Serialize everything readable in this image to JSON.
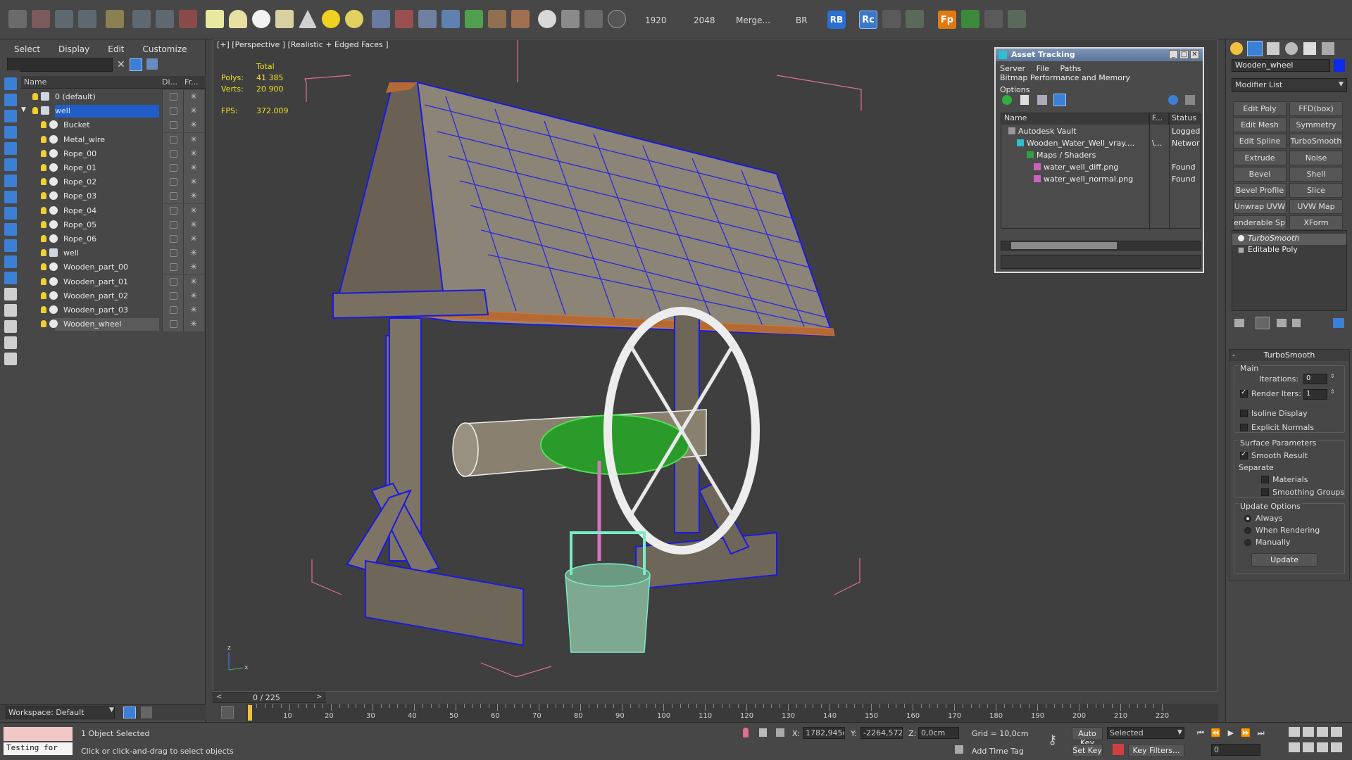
{
  "toolbar": {
    "width_value": "1920",
    "height_value": "2048",
    "merge_label": "Merge...",
    "br_label": "BR",
    "rb_label": "RB",
    "rc_label": "Rc",
    "fp_label": "Fp"
  },
  "scene_explorer": {
    "menu": [
      "Select",
      "Display",
      "Edit",
      "Customize"
    ],
    "columns": {
      "name": "Name",
      "display": "Di...",
      "freeze": "Fr..."
    },
    "rows": [
      {
        "label": "0 (default)",
        "level": 0,
        "kind": "layer"
      },
      {
        "label": "well",
        "level": 0,
        "kind": "layer",
        "selected": true
      },
      {
        "label": "Bucket",
        "level": 1,
        "kind": "object"
      },
      {
        "label": "Metal_wire",
        "level": 1,
        "kind": "object"
      },
      {
        "label": "Rope_00",
        "level": 1,
        "kind": "object"
      },
      {
        "label": "Rope_01",
        "level": 1,
        "kind": "object"
      },
      {
        "label": "Rope_02",
        "level": 1,
        "kind": "object"
      },
      {
        "label": "Rope_03",
        "level": 1,
        "kind": "object"
      },
      {
        "label": "Rope_04",
        "level": 1,
        "kind": "object"
      },
      {
        "label": "Rope_05",
        "level": 1,
        "kind": "object"
      },
      {
        "label": "Rope_06",
        "level": 1,
        "kind": "object"
      },
      {
        "label": "well",
        "level": 1,
        "kind": "layer"
      },
      {
        "label": "Wooden_part_00",
        "level": 1,
        "kind": "object"
      },
      {
        "label": "Wooden_part_01",
        "level": 1,
        "kind": "object"
      },
      {
        "label": "Wooden_part_02",
        "level": 1,
        "kind": "object"
      },
      {
        "label": "Wooden_part_03",
        "level": 1,
        "kind": "object"
      },
      {
        "label": "Wooden_wheel",
        "level": 1,
        "kind": "object",
        "highlighted": true
      }
    ],
    "workspace": "Workspace: Default"
  },
  "viewport": {
    "label": "[+] [Perspective ] [Realistic + Edged Faces ]",
    "stats": {
      "total_label": "Total",
      "polys_label": "Polys:",
      "polys_value": "41 385",
      "verts_label": "Verts:",
      "verts_value": "20 900",
      "fps_label": "FPS:",
      "fps_value": "372.009"
    },
    "axis_z": "z",
    "axis_x": "x"
  },
  "asset_tracking": {
    "title": "Asset Tracking",
    "menu": [
      "Server",
      "File",
      "Paths",
      "Bitmap Performance and Memory",
      "Options"
    ],
    "columns": [
      "Name",
      "F...",
      "Status"
    ],
    "rows": [
      {
        "name": "Autodesk Vault",
        "f": "",
        "status": "Logged C"
      },
      {
        "name": "Wooden_Water_Well_vray....",
        "f": "\\...",
        "status": "Network"
      },
      {
        "name": "Maps / Shaders",
        "f": "",
        "status": ""
      },
      {
        "name": "water_well_diff.png",
        "f": "",
        "status": "Found"
      },
      {
        "name": "water_well_normal.png",
        "f": "",
        "status": "Found"
      }
    ]
  },
  "command_panel": {
    "object_name": "Wooden_wheel",
    "object_color": "#0a2af0",
    "modifier_list": "Modifier List",
    "modifier_buttons": [
      "Edit Poly",
      "FFD(box)",
      "Edit Mesh",
      "Symmetry",
      "Edit Spline",
      "TurboSmooth",
      "Extrude",
      "Noise",
      "Bevel",
      "Shell",
      "Bevel Profile",
      "Slice",
      "Unwrap UVW",
      "UVW Map",
      "enderable Splir",
      "XForm"
    ],
    "stack": [
      "TurboSmooth",
      "Editable Poly"
    ],
    "turbosmooth": {
      "title": "TurboSmooth",
      "main_label": "Main",
      "iterations_label": "Iterations:",
      "iterations_value": "0",
      "render_iters_label": "Render Iters:",
      "render_iters_value": "1",
      "isoline_label": "Isoline Display",
      "explicit_normals_label": "Explicit Normals",
      "surface_params_label": "Surface Parameters",
      "smooth_result_label": "Smooth Result",
      "separate_label": "Separate",
      "materials_label": "Materials",
      "smoothing_groups_label": "Smoothing Groups",
      "update_options_label": "Update Options",
      "always_label": "Always",
      "when_rendering_label": "When Rendering",
      "manually_label": "Manually",
      "update_button": "Update"
    }
  },
  "timeline": {
    "frame_display": "0 / 225",
    "ticks": [
      "10",
      "20",
      "30",
      "40",
      "50",
      "60",
      "70",
      "80",
      "90",
      "100",
      "110",
      "120",
      "130",
      "140",
      "150",
      "160",
      "170",
      "180",
      "190",
      "200",
      "210",
      "220"
    ]
  },
  "status_bar": {
    "testing": "Testing for",
    "selection": "1 Object Selected",
    "prompt": "Click or click-and-drag to select objects",
    "x_label": "X:",
    "x_value": "1782,945c",
    "y_label": "Y:",
    "y_value": "-2264,572c",
    "z_label": "Z:",
    "z_value": "0,0cm",
    "grid": "Grid = 10,0cm",
    "add_time_tag": "Add Time Tag",
    "auto_key": "Auto Key",
    "set_key": "Set Key",
    "selected_dropdown": "Selected",
    "key_filters": "Key Filters...",
    "frame_value": "0"
  }
}
